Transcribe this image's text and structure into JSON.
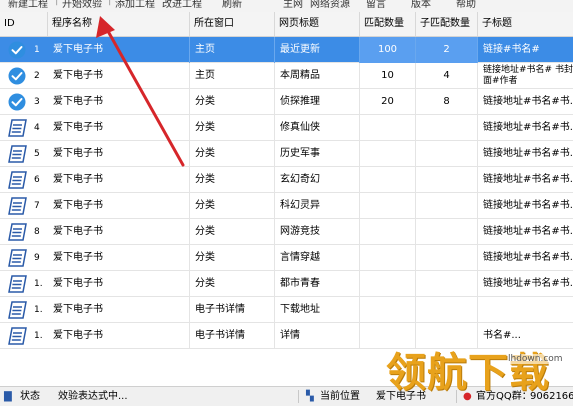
{
  "menu": {
    "items": [
      "新建工程",
      "开始效验",
      "添加工程",
      "改进工程",
      "刷新",
      "主网",
      "网络资源",
      "留言",
      "版本",
      "帮助"
    ]
  },
  "grid": {
    "columns": [
      "ID",
      "程序名称",
      "所在窗口",
      "网页标题",
      "匹配数量",
      "子匹配数量",
      "子标题"
    ],
    "rows": [
      {
        "id": "1",
        "icon": "check",
        "name": "爱下电子书",
        "window": "主页",
        "title": "最近更新",
        "match": "100",
        "submatch": "2",
        "subtitle": "链接#书名#"
      },
      {
        "id": "2",
        "icon": "check",
        "name": "爱下电子书",
        "window": "主页",
        "title": "本周精品",
        "match": "10",
        "submatch": "4",
        "subtitle": "链接地址#书名# 书封面#作者"
      },
      {
        "id": "3",
        "icon": "check",
        "name": "爱下电子书",
        "window": "分类",
        "title": "侦探推理",
        "match": "20",
        "submatch": "8",
        "subtitle": "链接地址#书名#书..."
      },
      {
        "id": "4",
        "icon": "doc",
        "name": "爱下电子书",
        "window": "分类",
        "title": "修真仙侠",
        "match": "",
        "submatch": "",
        "subtitle": "链接地址#书名#书..."
      },
      {
        "id": "5",
        "icon": "doc",
        "name": "爱下电子书",
        "window": "分类",
        "title": "历史军事",
        "match": "",
        "submatch": "",
        "subtitle": "链接地址#书名#书..."
      },
      {
        "id": "6",
        "icon": "doc",
        "name": "爱下电子书",
        "window": "分类",
        "title": "玄幻奇幻",
        "match": "",
        "submatch": "",
        "subtitle": "链接地址#书名#书..."
      },
      {
        "id": "7",
        "icon": "doc",
        "name": "爱下电子书",
        "window": "分类",
        "title": "科幻灵异",
        "match": "",
        "submatch": "",
        "subtitle": "链接地址#书名#书..."
      },
      {
        "id": "8",
        "icon": "doc",
        "name": "爱下电子书",
        "window": "分类",
        "title": "网游竞技",
        "match": "",
        "submatch": "",
        "subtitle": "链接地址#书名#书..."
      },
      {
        "id": "9",
        "icon": "doc",
        "name": "爱下电子书",
        "window": "分类",
        "title": "言情穿越",
        "match": "",
        "submatch": "",
        "subtitle": "链接地址#书名#书..."
      },
      {
        "id": "1.",
        "icon": "doc",
        "name": "爱下电子书",
        "window": "分类",
        "title": "都市青春",
        "match": "",
        "submatch": "",
        "subtitle": "链接地址#书名#书..."
      },
      {
        "id": "1.",
        "icon": "doc",
        "name": "爱下电子书",
        "window": "电子书详情",
        "title": "下载地址",
        "match": "",
        "submatch": "",
        "subtitle": ""
      },
      {
        "id": "1.",
        "icon": "doc",
        "name": "爱下电子书",
        "window": "电子书详情",
        "title": "详情",
        "match": "",
        "submatch": "",
        "subtitle": "书名#..."
      }
    ]
  },
  "status": {
    "state_label": "状态",
    "state_value": "效验表达式中...",
    "position_label": "当前位置",
    "position_value": "爱下电子书",
    "qq_label": "官方QQ群：",
    "qq_value": "9062166"
  },
  "watermark": {
    "text": "领航下载",
    "url": "lhdown.com"
  },
  "colors": {
    "selected_row": "#3c8ce6",
    "check_icon": "#2f8ee0",
    "doc_icon": "#2a5aa8",
    "arrow": "#d6262a",
    "watermark": "#e8a21c"
  }
}
